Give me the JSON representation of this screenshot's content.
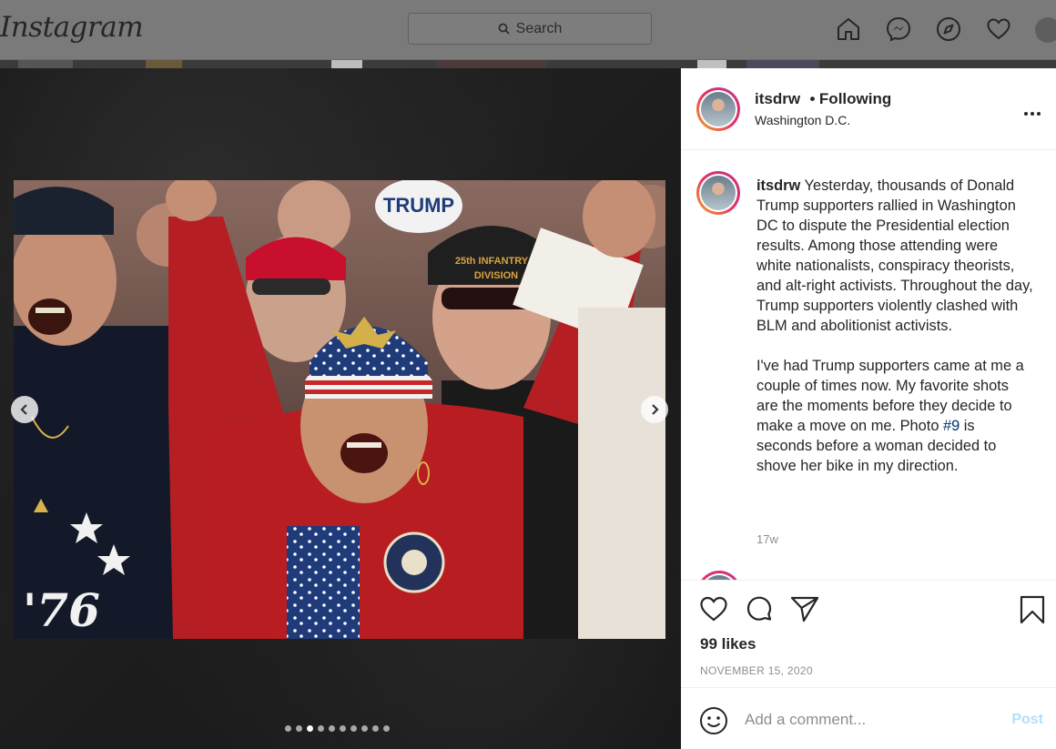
{
  "nav": {
    "logo": "Instagram",
    "search_placeholder": "Search",
    "icons": [
      "home-icon",
      "messenger-icon",
      "explore-icon",
      "heart-icon",
      "profile-avatar"
    ]
  },
  "post": {
    "username": "itsdrw",
    "follow_status": "Following",
    "separator": "•",
    "location": "Washington D.C.",
    "more_label": "•••",
    "photo_alt": "Crowd of Trump supporters at a rally in Washington DC",
    "photo_signs": [
      "TRUMP",
      "25th INFANTRY DIVISION",
      "76"
    ],
    "carousel": {
      "total": 10,
      "active_index": 2
    },
    "caption": {
      "username": "itsdrw",
      "paragraph1": "Yesterday, thousands of Donald Trump supporters rallied in Washington DC to dispute the Presidential election results. Among those attending were white nationalists, conspiracy theorists, and alt-right activists. Throughout the day, Trump supporters violently clashed with BLM and abolitionist activists.",
      "paragraph2_before": "I've had Trump supporters came at me a couple of times now. My favorite shots are the moments before they decide to make a move on me. Photo ",
      "paragraph2_tag": "#9",
      "paragraph2_after": " is seconds before a woman decided to shove her bike in my direction."
    },
    "age": "17w",
    "likes": "99 likes",
    "date": "NOVEMBER 15, 2020",
    "comment_placeholder": "Add a comment...",
    "post_button": "Post"
  },
  "colors": {
    "accent_link": "#00376b",
    "post_button_disabled": "#b2dffc",
    "story_ring": [
      "#f9a825",
      "#e1306c",
      "#c13584"
    ]
  }
}
